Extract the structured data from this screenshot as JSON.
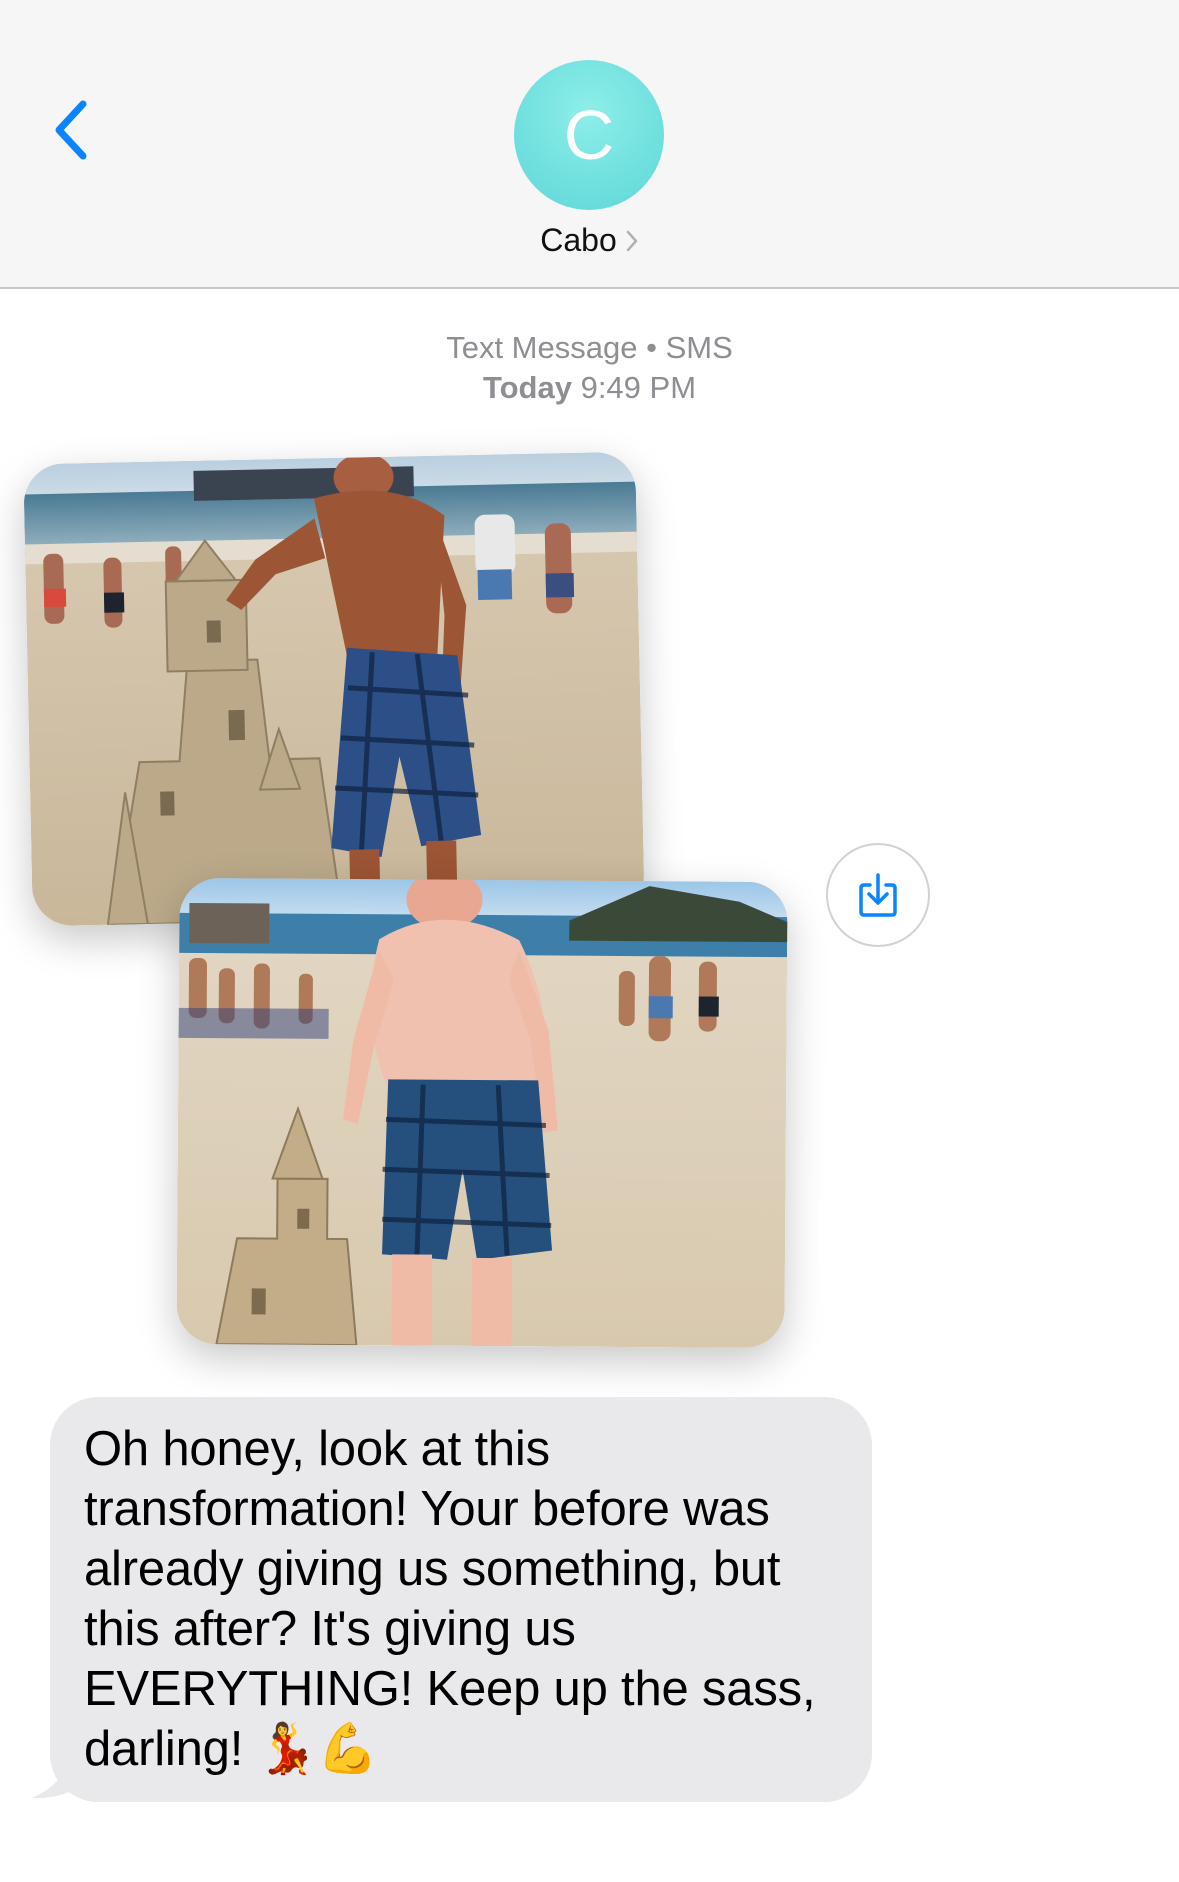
{
  "header": {
    "back_icon": "chevron-left-icon",
    "avatar_initial": "C",
    "contact_name": "Cabo",
    "contact_chevron_icon": "chevron-right-icon",
    "accent_color": "#0a84ff",
    "avatar_color": "#6fe0de"
  },
  "thread": {
    "service_label": "Text Message",
    "separator": "•",
    "service_type": "SMS",
    "day": "Today",
    "time": "9:49 PM"
  },
  "attachments": {
    "save_icon": "download-icon",
    "images": [
      {
        "description_icon": "photo-icon"
      },
      {
        "description_icon": "photo-icon"
      }
    ]
  },
  "message": {
    "text": "Oh honey, look at this transformation! Your before was already giving us something, but this after? It's giving us EVERYTHING! Keep up the sass, darling!",
    "emoji": "💃💪",
    "bubble_color": "#e9e9eb"
  }
}
